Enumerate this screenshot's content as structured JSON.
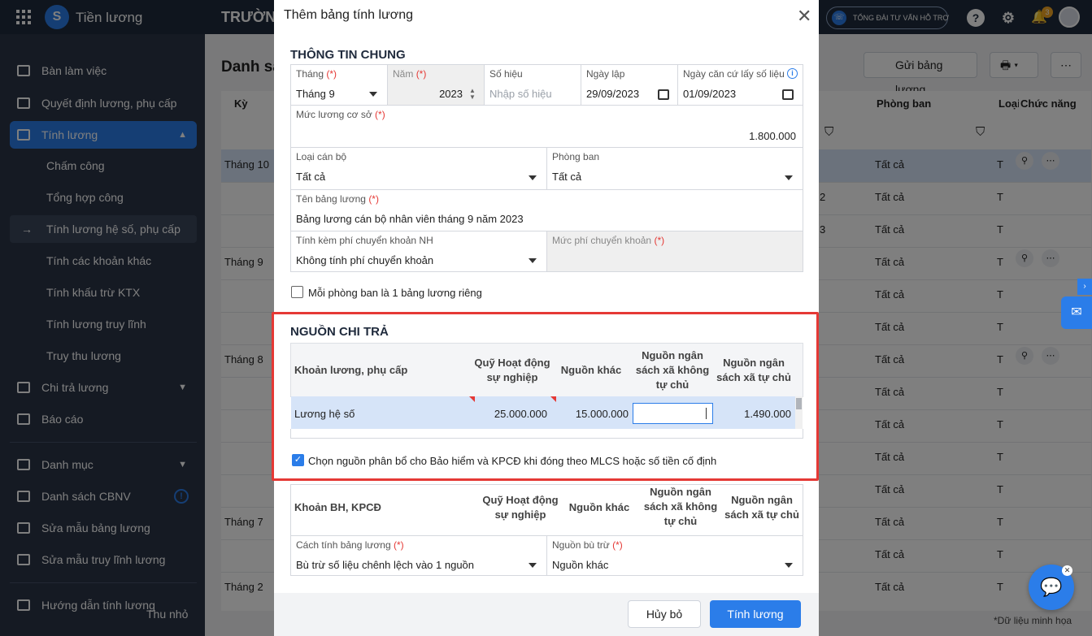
{
  "app": {
    "name": "Tiền lương",
    "logo_letter": "S",
    "org": "TRƯỜNG",
    "hotline": "TỔNG ĐÀI TƯ VẤN HỖ TRỢ",
    "notif_count": "3"
  },
  "sidebar": {
    "items": [
      {
        "label": "Bàn làm việc"
      },
      {
        "label": "Quyết định lương, phụ cấp"
      },
      {
        "label": "Tính lương"
      },
      {
        "label": "Chi trả lương"
      },
      {
        "label": "Báo cáo"
      },
      {
        "label": "Danh mục"
      },
      {
        "label": "Danh sách CBNV"
      },
      {
        "label": "Sửa mẫu bảng lương"
      },
      {
        "label": "Sửa mẫu truy lĩnh lương"
      },
      {
        "label": "Hướng dẫn tính lương"
      }
    ],
    "sub": [
      "Chấm công",
      "Tổng hợp công",
      "Tính lương hệ số, phụ cấp",
      "Tính các khoản khác",
      "Tính khấu trừ KTX",
      "Tính lương truy lĩnh",
      "Truy thu lương"
    ],
    "collapse": "Thu nhỏ"
  },
  "main": {
    "title": "Danh sa",
    "send_btn": "Gửi bảng lương",
    "col_ky": "Kỳ",
    "col_phongban": "Phòng ban",
    "col_loai": "Loại",
    "col_chucnang": "Chức năng",
    "months": [
      "Tháng 10",
      "Tháng 9",
      "Tháng 8",
      "Tháng 7",
      "Tháng 2"
    ],
    "all": "Tất cả",
    "t": "T",
    "frag2": "2",
    "frag3": "3"
  },
  "modal": {
    "title": "Thêm bảng tính lương",
    "general_title": "THÔNG TIN CHUNG",
    "thang_label": "Tháng",
    "thang_value": "Tháng 9",
    "nam_label": "Năm",
    "nam_value": "2023",
    "sohieu_label": "Số hiệu",
    "sohieu_placeholder": "Nhập số hiệu",
    "ngaylap_label": "Ngày lập",
    "ngaylap_value": "29/09/2023",
    "ngaycancu_label": "Ngày căn cứ lấy số liệu",
    "ngaycancu_value": "01/09/2023",
    "mucluong_label": "Mức lương cơ sở",
    "mucluong_value": "1.800.000",
    "loaicb_label": "Loại cán bộ",
    "loaicb_value": "Tất cả",
    "phongban_label": "Phòng ban",
    "phongban_value": "Tất cả",
    "tenbang_label": "Tên bảng lương",
    "tenbang_value": "Bảng lương cán bộ nhân viên tháng 9 năm 2023",
    "phick_label": "Tính kèm phí chuyển khoản NH",
    "phick_value": "Không tính phí chuyển khoản",
    "mucphi_label": "Mức phí chuyển khoản",
    "req": "(*)",
    "rieng_label": "Mỗi phòng ban là 1 bảng lương riêng",
    "source_title": "NGUỒN CHI TRẢ",
    "grid1_headers": [
      "Khoản lương, phụ cấp",
      "Quỹ Hoạt động sự nghiệp",
      "Nguồn khác",
      "Nguồn ngân sách xã không tự chủ",
      "Nguồn ngân sách xã tự chủ"
    ],
    "grid1_row": {
      "name": "Lương hệ số",
      "quy": "25.000.000",
      "khac": "15.000.000",
      "khongtuchu": "",
      "tuchu": "1.490.000"
    },
    "bh_check_label": "Chọn nguồn phân bổ cho Bảo hiểm và KPCĐ khi đóng theo MLCS hoặc số tiền cố định",
    "grid2_headers": [
      "Khoản BH, KPCĐ",
      "Quỹ Hoạt động sự nghiệp",
      "Nguồn khác",
      "Nguồn ngân sách xã không tự chủ",
      "Nguồn ngân sách xã tự chủ"
    ],
    "cachtinh_label": "Cách tính bảng lương",
    "cachtinh_value": "Bù trừ số liệu chênh lệch vào 1 nguồn",
    "nguonbu_label": "Nguồn bù trừ",
    "nguonbu_value": "Nguồn khác",
    "cancel": "Hủy bỏ",
    "submit": "Tính lương"
  },
  "note": "*Dữ liệu minh họa",
  "colors": {
    "primary": "#2b7de9",
    "sidebar": "#2b3547",
    "topbar": "#1f2a3c",
    "highlight": "#e53935"
  }
}
